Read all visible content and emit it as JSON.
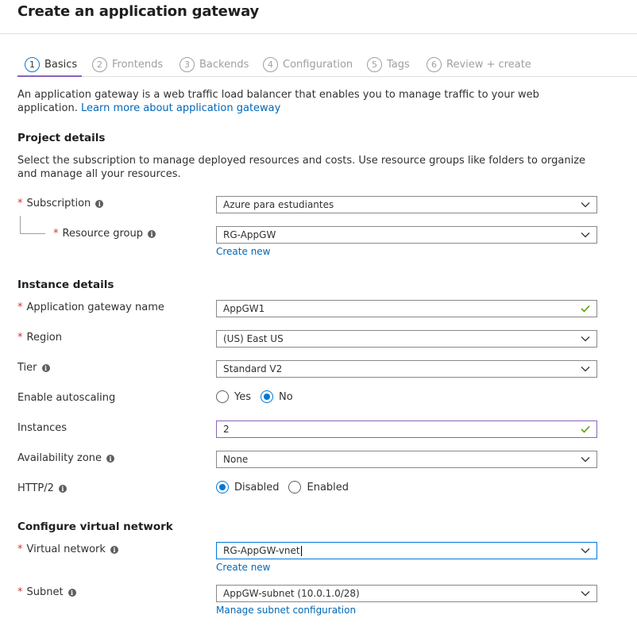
{
  "page": {
    "title": "Create an application gateway"
  },
  "tabs": [
    {
      "num": "1",
      "label": "Basics"
    },
    {
      "num": "2",
      "label": "Frontends"
    },
    {
      "num": "3",
      "label": "Backends"
    },
    {
      "num": "4",
      "label": "Configuration"
    },
    {
      "num": "5",
      "label": "Tags"
    },
    {
      "num": "6",
      "label": "Review + create"
    }
  ],
  "intro": {
    "text": "An application gateway is a web traffic load balancer that enables you to manage traffic to your web application. ",
    "link": "Learn more about application gateway"
  },
  "project": {
    "heading": "Project details",
    "description": "Select the subscription to manage deployed resources and costs. Use resource groups like folders to organize and manage all your resources.",
    "subscription_label": "Subscription",
    "subscription_value": "Azure para estudiantes",
    "rg_label": "Resource group",
    "rg_value": "RG-AppGW",
    "rg_create_new": "Create new"
  },
  "instance": {
    "heading": "Instance details",
    "name_label": "Application gateway name",
    "name_value": "AppGW1",
    "region_label": "Region",
    "region_value": "(US) East US",
    "tier_label": "Tier",
    "tier_value": "Standard V2",
    "autoscale_label": "Enable autoscaling",
    "autoscale_yes": "Yes",
    "autoscale_no": "No",
    "instances_label": "Instances",
    "instances_value": "2",
    "zone_label": "Availability zone",
    "zone_value": "None",
    "http2_label": "HTTP/2",
    "http2_disabled": "Disabled",
    "http2_enabled": "Enabled"
  },
  "network": {
    "heading": "Configure virtual network",
    "vnet_label": "Virtual network",
    "vnet_value": "RG-AppGW-vnet",
    "vnet_create_new": "Create new",
    "subnet_label": "Subnet",
    "subnet_value": "AppGW-subnet (10.0.1.0/28)",
    "subnet_manage": "Manage subnet configuration"
  },
  "colors": {
    "accent": "#0078d4",
    "tab_underline": "#8764b8",
    "required": "#d13438",
    "valid": "#57a300",
    "link": "#0067b8"
  },
  "icons": {
    "dropdown": "chevron-down-icon",
    "valid": "checkmark-icon",
    "info": "info-icon"
  }
}
